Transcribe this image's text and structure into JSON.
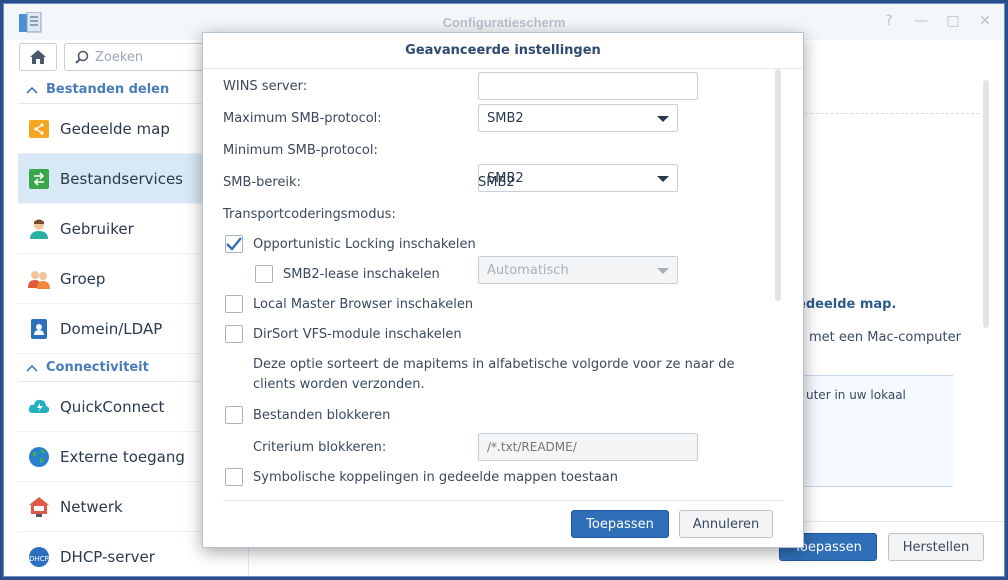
{
  "window": {
    "title": "Configuratiescherm"
  },
  "toolbar": {
    "search_placeholder": "Zoeken"
  },
  "sidebar": {
    "sections": [
      {
        "label": "Bestanden delen"
      },
      {
        "label": "Connectiviteit"
      }
    ],
    "items": [
      {
        "label": "Gedeelde map",
        "icon": "shared-folder-icon"
      },
      {
        "label": "Bestandservices",
        "icon": "file-services-icon",
        "active": true
      },
      {
        "label": "Gebruiker",
        "icon": "user-icon"
      },
      {
        "label": "Groep",
        "icon": "group-icon"
      },
      {
        "label": "Domein/LDAP",
        "icon": "domain-ldap-icon"
      },
      {
        "label": "QuickConnect",
        "icon": "quickconnect-icon"
      },
      {
        "label": "Externe toegang",
        "icon": "external-access-icon"
      },
      {
        "label": "Netwerk",
        "icon": "network-icon"
      },
      {
        "label": "DHCP-server",
        "icon": "dhcp-server-icon"
      }
    ]
  },
  "main": {
    "link_fragment": "edeelde map.",
    "text_fragment": "met een Mac-computer",
    "box_fragment": "uter in uw lokaal",
    "apply_label": "Toepassen",
    "reset_label": "Herstellen"
  },
  "modal": {
    "title": "Geavanceerde instellingen",
    "wins_label": "WINS server:",
    "wins_value": "",
    "max_smb_label": "Maximum SMB-protocol:",
    "max_smb_value": "SMB2",
    "min_smb_label": "Minimum SMB-protocol:",
    "min_smb_value": "SMB2",
    "smb_range_label": "SMB-bereik:",
    "smb_range_value": "SMB2",
    "transport_label": "Transportcoderingsmodus:",
    "transport_value": "Automatisch",
    "opportunistic_label": "Opportunistic Locking inschakelen",
    "opportunistic_checked": true,
    "smb2_lease_label": "SMB2-lease inschakelen",
    "smb2_lease_checked": false,
    "local_master_label": "Local Master Browser inschakelen",
    "local_master_checked": false,
    "dirsort_label": "DirSort VFS-module inschakelen",
    "dirsort_checked": false,
    "dirsort_desc": "Deze optie sorteert de mapitems in alfabetische volgorde voor ze naar de clients worden verzonden.",
    "block_files_label": "Bestanden blokkeren",
    "block_files_checked": false,
    "block_criteria_label": "Criterium blokkeren:",
    "block_criteria_placeholder": "/*.txt/README/",
    "symlinks_label": "Symbolische koppelingen in gedeelde mappen toestaan",
    "symlinks_checked": false,
    "apply_label": "Toepassen",
    "cancel_label": "Annuleren"
  },
  "colors": {
    "accent": "#2f6fb8",
    "sidebar_active": "#d8e8f6",
    "section_head": "#4a7db8"
  }
}
